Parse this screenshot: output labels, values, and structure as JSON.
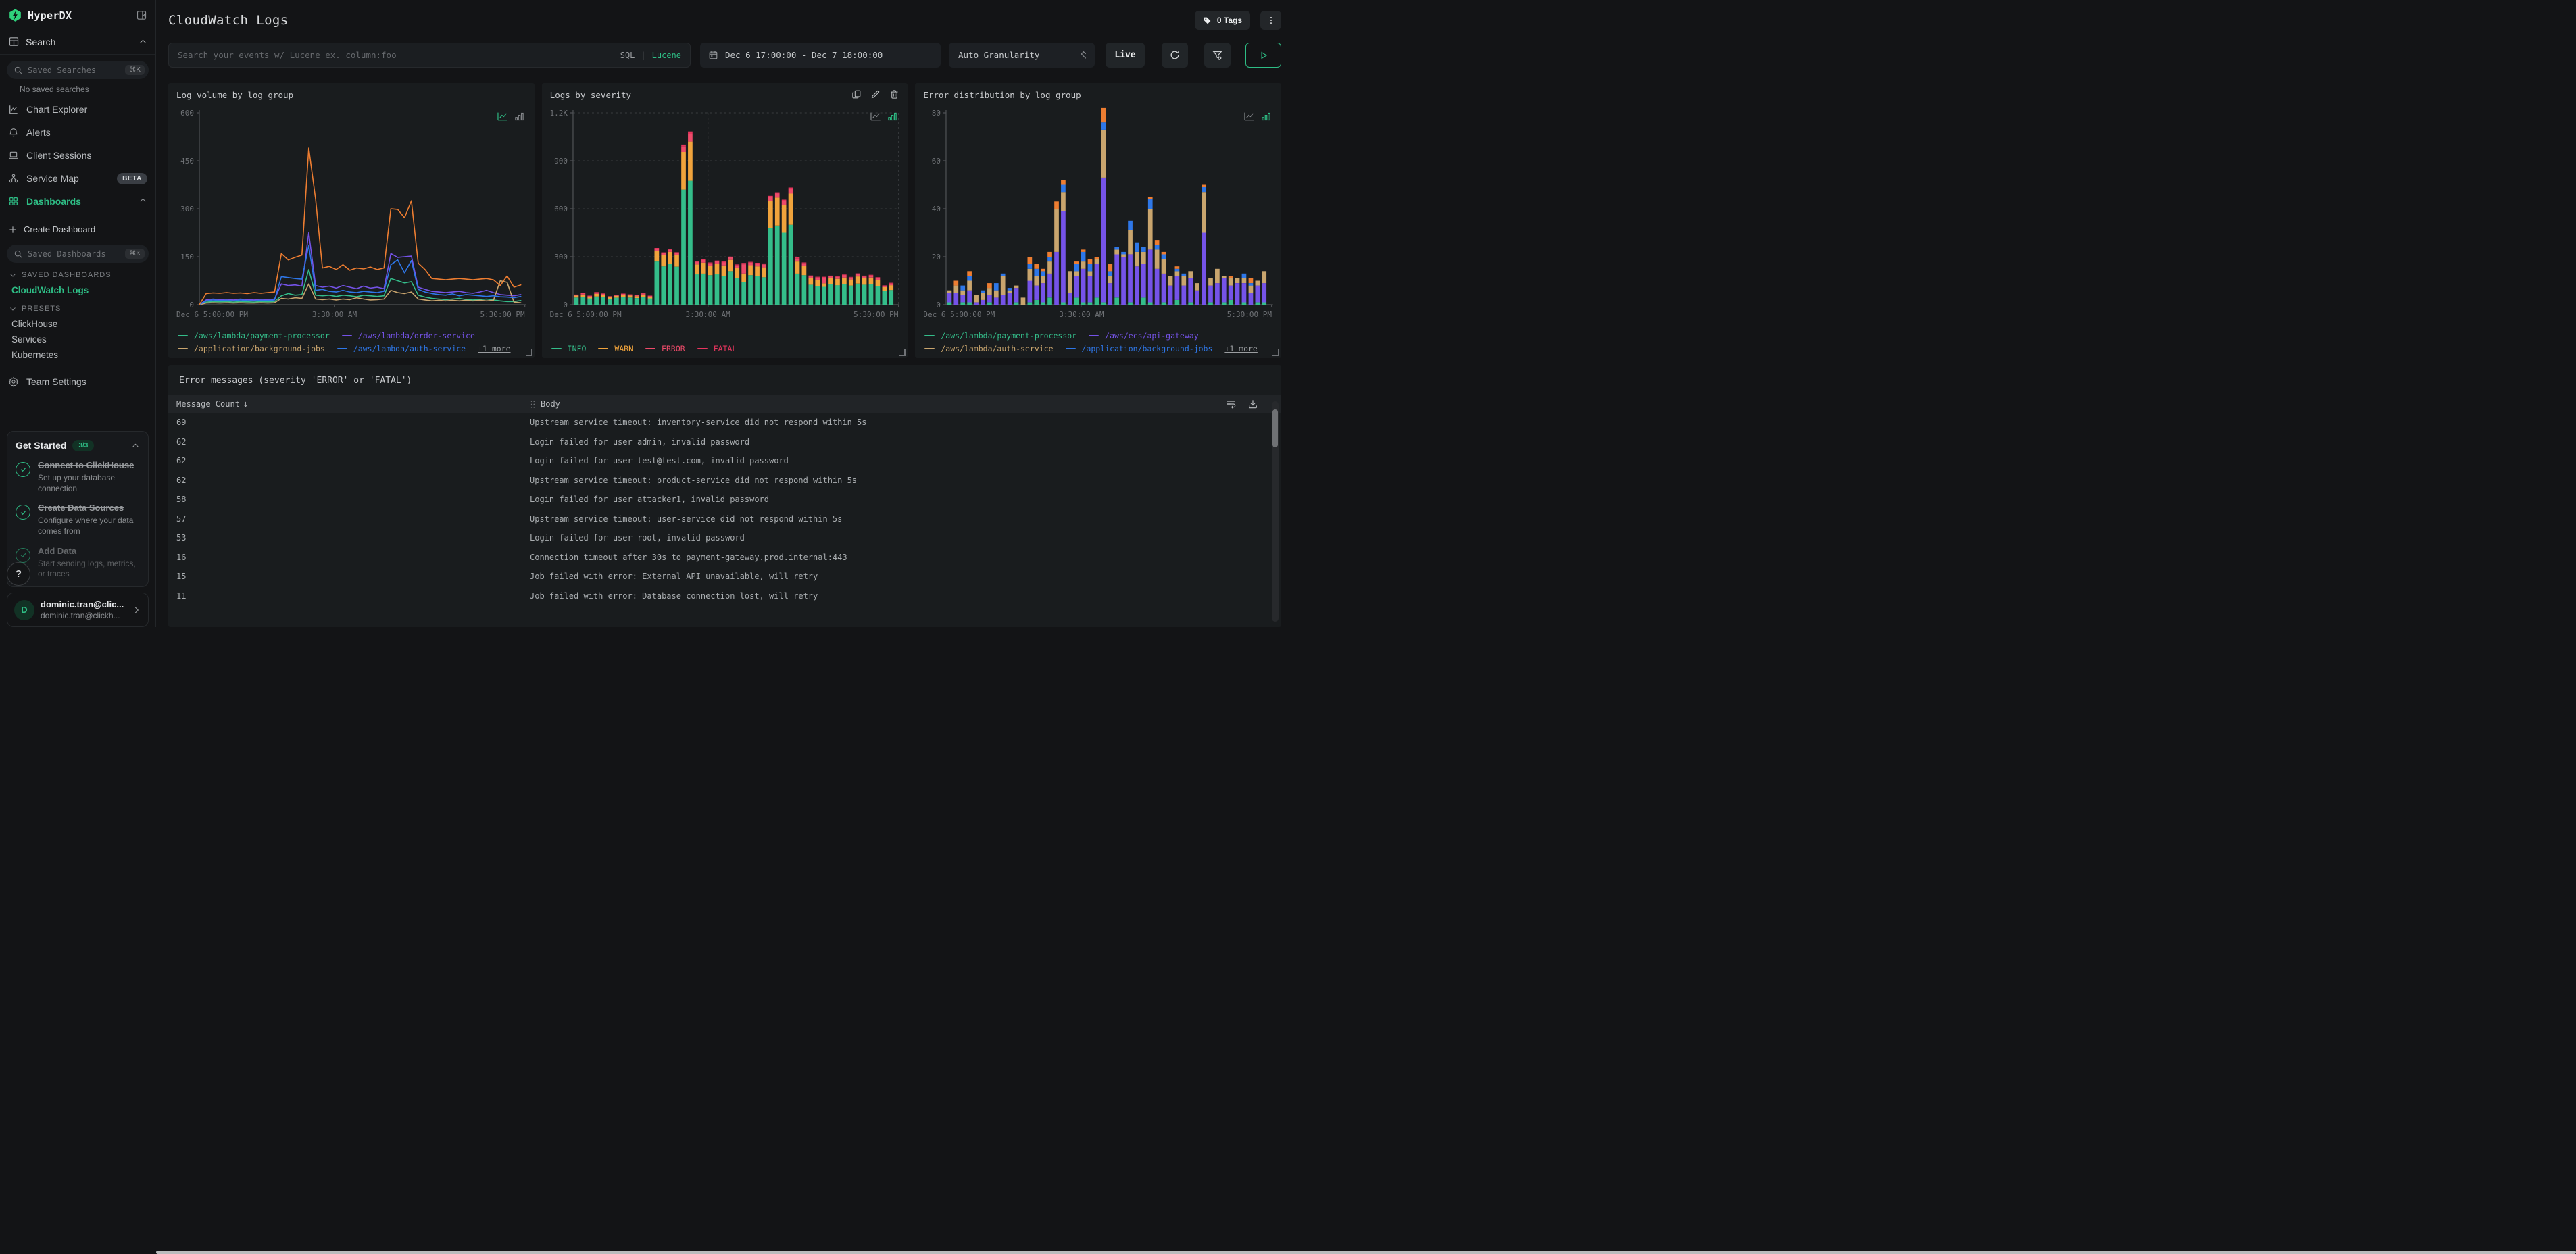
{
  "app": {
    "name": "HyperDX"
  },
  "sidebar": {
    "search_section_label": "Search",
    "saved_searches_placeholder": "Saved Searches",
    "shortcut": "⌘K",
    "no_saved": "No saved searches",
    "nav": [
      {
        "icon": "chart-explorer",
        "label": "Chart Explorer"
      },
      {
        "icon": "bell",
        "label": "Alerts"
      },
      {
        "icon": "laptop",
        "label": "Client Sessions"
      },
      {
        "icon": "service-map",
        "label": "Service Map",
        "badge": "BETA"
      },
      {
        "icon": "dashboards",
        "label": "Dashboards",
        "active": true,
        "chevron": "up"
      }
    ],
    "create_dashboard": "Create Dashboard",
    "saved_dashboards_placeholder": "Saved Dashboards",
    "sections": [
      {
        "label": "SAVED DASHBOARDS",
        "items": [
          {
            "label": "CloudWatch Logs",
            "active": true
          }
        ]
      },
      {
        "label": "PRESETS",
        "items": [
          {
            "label": "ClickHouse"
          },
          {
            "label": "Services"
          },
          {
            "label": "Kubernetes"
          }
        ]
      }
    ],
    "team_settings": "Team Settings",
    "get_started": {
      "title": "Get Started",
      "badge": "3/3",
      "items": [
        {
          "title": "Connect to ClickHouse",
          "desc": "Set up your database connection",
          "done": true
        },
        {
          "title": "Create Data Sources",
          "desc": "Configure where your data comes from",
          "done": true
        },
        {
          "title": "Add Data",
          "desc": "Start sending logs, metrics, or traces",
          "done": true
        }
      ]
    },
    "help_label": "?",
    "user": {
      "initial": "D",
      "name": "dominic.tran@clic...",
      "email": "dominic.tran@clickh..."
    }
  },
  "header": {
    "title": "CloudWatch Logs",
    "tags_label": "0 Tags"
  },
  "toolbar": {
    "search_placeholder": "Search your events w/ Lucene ex. column:foo",
    "sql_label": "SQL",
    "divider": "|",
    "lucene_label": "Lucene",
    "time_range": "Dec 6 17:00:00 - Dec 7 18:00:00",
    "granularity": "Auto Granularity",
    "live_label": "Live"
  },
  "colors": {
    "accent": "#2ebd85",
    "orange": "#ed7d31",
    "purple": "#7553e8",
    "blue": "#2e77e8",
    "tan": "#c9a56e",
    "green": "#34bd8a",
    "warn": "#f0a33c",
    "error": "#ee4b6a",
    "fatal": "#e8355e"
  },
  "chart_data": [
    {
      "id": "log-volume",
      "type": "line",
      "title": "Log volume by log group",
      "ylim": [
        0,
        600
      ],
      "yticks": [
        0,
        150,
        300,
        450,
        600
      ],
      "ytick_labels": [
        "0",
        "150",
        "300",
        "450",
        "600"
      ],
      "xticks": [
        "Dec 6 5:00:00 PM",
        "3:30:00 AM",
        "5:30:00 PM"
      ],
      "grid": false,
      "active_view": "line",
      "series": [
        {
          "name": "/aws/lambda/payment-processor",
          "color": "#34bd8a",
          "values": [
            0,
            8,
            10,
            9,
            10,
            8,
            10,
            9,
            8,
            10,
            9,
            10,
            28,
            35,
            30,
            32,
            110,
            30,
            28,
            30,
            26,
            30,
            28,
            25,
            30,
            28,
            26,
            28,
            82,
            75,
            68,
            72,
            30,
            24,
            20,
            18,
            16,
            18,
            20,
            16,
            15,
            16,
            18,
            15,
            12,
            10,
            10,
            13
          ]
        },
        {
          "name": "/aws/lambda/order-service",
          "color": "#7553e8",
          "values": [
            0,
            15,
            18,
            16,
            17,
            15,
            18,
            16,
            15,
            17,
            16,
            18,
            65,
            60,
            62,
            58,
            225,
            60,
            55,
            58,
            52,
            60,
            55,
            50,
            58,
            52,
            55,
            50,
            160,
            148,
            150,
            152,
            55,
            48,
            42,
            40,
            38,
            40,
            42,
            38,
            36,
            40,
            45,
            38,
            32,
            30,
            28,
            32
          ]
        },
        {
          "name": "/application/background-jobs",
          "color": "#c9a56e",
          "values": [
            0,
            5,
            6,
            5,
            6,
            5,
            6,
            5,
            5,
            6,
            5,
            6,
            20,
            18,
            22,
            20,
            65,
            18,
            16,
            18,
            15,
            18,
            16,
            22,
            18,
            15,
            16,
            18,
            45,
            38,
            35,
            40,
            18,
            15,
            12,
            14,
            12,
            14,
            12,
            14,
            12,
            14,
            12,
            14,
            75,
            70,
            8,
            6
          ]
        },
        {
          "name": "/aws/lambda/auth-service",
          "color": "#2e77e8",
          "values": [
            0,
            12,
            15,
            13,
            14,
            12,
            15,
            13,
            12,
            14,
            13,
            15,
            88,
            85,
            82,
            80,
            185,
            45,
            48,
            42,
            40,
            45,
            40,
            38,
            42,
            40,
            38,
            42,
            125,
            140,
            100,
            138,
            48,
            40,
            35,
            32,
            30,
            34,
            28,
            32,
            30,
            28,
            26,
            28,
            25,
            24,
            22,
            26
          ]
        },
        {
          "name": "+1 more",
          "color": "#ed7d31",
          "values": [
            0,
            35,
            37,
            36,
            38,
            36,
            37,
            35,
            38,
            36,
            38,
            40,
            160,
            140,
            148,
            155,
            490,
            330,
            115,
            120,
            110,
            125,
            108,
            115,
            112,
            118,
            110,
            115,
            300,
            298,
            272,
            325,
            130,
            110,
            82,
            80,
            78,
            80,
            82,
            80,
            78,
            80,
            82,
            78,
            60,
            90,
            55,
            62
          ]
        }
      ],
      "legend": [
        {
          "label": "/aws/lambda/payment-processor",
          "color": "#34bd8a"
        },
        {
          "label": "/aws/lambda/order-service",
          "color": "#7553e8"
        },
        {
          "label": "/application/background-jobs",
          "color": "#c9a56e"
        },
        {
          "label": "/aws/lambda/auth-service",
          "color": "#2e77e8"
        },
        {
          "label": "+1 more",
          "more": true
        }
      ],
      "legend_split": 2
    },
    {
      "id": "logs-by-severity",
      "type": "bar",
      "title": "Logs by severity",
      "ylim": [
        0,
        1200
      ],
      "yticks": [
        0,
        300,
        600,
        900,
        1200
      ],
      "ytick_labels": [
        "0",
        "300",
        "600",
        "900",
        "1.2K"
      ],
      "xticks": [
        "Dec 6 5:00:00 PM",
        "3:30:00 AM",
        "5:30:00 PM"
      ],
      "grid": true,
      "active_view": "bar",
      "hover_actions": true,
      "series": [
        {
          "name": "INFO",
          "color": "#34bd8a",
          "values": [
            45,
            50,
            40,
            52,
            48,
            38,
            44,
            48,
            45,
            42,
            50,
            40,
            270,
            240,
            255,
            238,
            720,
            775,
            190,
            195,
            185,
            190,
            178,
            210,
            168,
            140,
            185,
            180,
            172,
            478,
            495,
            450,
            500,
            195,
            185,
            125,
            118,
            112,
            128,
            122,
            128,
            120,
            132,
            125,
            128,
            118,
            85,
            92
          ]
        },
        {
          "name": "WARN",
          "color": "#f0a33c",
          "values": [
            12,
            14,
            10,
            16,
            15,
            10,
            12,
            14,
            12,
            12,
            14,
            10,
            65,
            70,
            75,
            72,
            235,
            245,
            62,
            68,
            60,
            65,
            68,
            70,
            62,
            55,
            62,
            60,
            62,
            170,
            175,
            172,
            195,
            75,
            60,
            42,
            38,
            22,
            38,
            40,
            42,
            38,
            45,
            40,
            42,
            38,
            25,
            30
          ]
        },
        {
          "name": "ERROR",
          "color": "#ee4b6a",
          "values": [
            5,
            6,
            5,
            8,
            6,
            4,
            5,
            6,
            6,
            6,
            7,
            5,
            15,
            12,
            14,
            14,
            35,
            45,
            16,
            16,
            14,
            16,
            18,
            16,
            16,
            58,
            16,
            16,
            18,
            25,
            25,
            25,
            28,
            20,
            14,
            12,
            14,
            35,
            12,
            12,
            14,
            12,
            14,
            12,
            12,
            12,
            8,
            10
          ]
        },
        {
          "name": "FATAL",
          "color": "#e8355e",
          "values": [
            2,
            2,
            2,
            3,
            2,
            2,
            2,
            2,
            2,
            3,
            2,
            2,
            5,
            5,
            5,
            4,
            12,
            18,
            5,
            5,
            5,
            5,
            6,
            5,
            6,
            8,
            5,
            6,
            6,
            8,
            8,
            10,
            10,
            6,
            5,
            4,
            5,
            6,
            4,
            5,
            5,
            4,
            5,
            5,
            5,
            4,
            3,
            5
          ]
        }
      ],
      "legend": [
        {
          "label": "INFO",
          "color": "#34bd8a"
        },
        {
          "label": "WARN",
          "color": "#f0a33c"
        },
        {
          "label": "ERROR",
          "color": "#ee4b6a"
        },
        {
          "label": "FATAL",
          "color": "#e8355e"
        }
      ],
      "legend_split": 4
    },
    {
      "id": "error-distribution",
      "type": "bar",
      "title": "Error distribution by log group",
      "ylim": [
        0,
        80
      ],
      "yticks": [
        0,
        20,
        40,
        60,
        80
      ],
      "ytick_labels": [
        "0",
        "20",
        "40",
        "60",
        "80"
      ],
      "xticks": [
        "Dec 6 5:00:00 PM",
        "3:30:00 AM",
        "5:30:00 PM"
      ],
      "grid": false,
      "active_view": "bar",
      "series": [
        {
          "name": "/aws/lambda/payment-processor",
          "color": "#34bd8a",
          "values": [
            1,
            0,
            1,
            1,
            0,
            0,
            1,
            0,
            0,
            0,
            1,
            0,
            1,
            2,
            1,
            3,
            0,
            1,
            0,
            3,
            1,
            1,
            3,
            1,
            0,
            3,
            0,
            1,
            0,
            3,
            1,
            0,
            1,
            0,
            2,
            0,
            1,
            0,
            0,
            1,
            0,
            1,
            2,
            0,
            1,
            0,
            1,
            1
          ]
        },
        {
          "name": "/aws/ecs/api-gateway",
          "color": "#7553e8",
          "values": [
            4,
            5,
            3,
            5,
            1,
            2,
            3,
            3,
            4,
            5,
            6,
            0,
            9,
            6,
            8,
            10,
            22,
            38,
            5,
            9,
            14,
            11,
            14,
            52,
            9,
            18,
            20,
            20,
            16,
            14,
            22,
            15,
            12,
            8,
            10,
            8,
            10,
            6,
            30,
            7,
            9,
            10,
            6,
            9,
            8,
            5,
            7,
            8
          ]
        },
        {
          "name": "/aws/lambda/auth-service",
          "color": "#c9a56e",
          "values": [
            1,
            3,
            2,
            4,
            3,
            3,
            3,
            3,
            8,
            1,
            1,
            3,
            5,
            4,
            3,
            5,
            18,
            8,
            9,
            2,
            3,
            2,
            2,
            20,
            3,
            2,
            1,
            10,
            6,
            5,
            17,
            8,
            6,
            4,
            2,
            4,
            3,
            3,
            17,
            3,
            6,
            1,
            3,
            2,
            2,
            3,
            2,
            5
          ]
        },
        {
          "name": "/application/background-jobs",
          "color": "#2e77e8",
          "values": [
            0,
            0,
            2,
            2,
            0,
            1,
            0,
            3,
            1,
            1,
            0,
            0,
            2,
            3,
            2,
            2,
            0,
            3,
            0,
            3,
            4,
            3,
            0,
            3,
            2,
            1,
            1,
            4,
            4,
            2,
            4,
            2,
            2,
            0,
            1,
            1,
            0,
            0,
            2,
            0,
            0,
            0,
            0,
            0,
            2,
            1,
            0,
            0
          ]
        },
        {
          "name": "+1 more",
          "color": "#ed7d31",
          "values": [
            0,
            2,
            0,
            2,
            0,
            0,
            2,
            0,
            0,
            0,
            0,
            0,
            3,
            2,
            1,
            2,
            3,
            2,
            0,
            1,
            1,
            2,
            1,
            6,
            3,
            0,
            0,
            0,
            0,
            0,
            1,
            2,
            1,
            0,
            1,
            0,
            0,
            0,
            1,
            0,
            0,
            0,
            1,
            0,
            0,
            2,
            0,
            0
          ]
        }
      ],
      "legend": [
        {
          "label": "/aws/lambda/payment-processor",
          "color": "#34bd8a"
        },
        {
          "label": "/aws/ecs/api-gateway",
          "color": "#7553e8"
        },
        {
          "label": "/aws/lambda/auth-service",
          "color": "#c9a56e"
        },
        {
          "label": "/application/background-jobs",
          "color": "#2e77e8"
        },
        {
          "label": "+1 more",
          "more": true
        }
      ],
      "legend_split": 2
    }
  ],
  "table": {
    "title": "Error messages (severity 'ERROR' or 'FATAL')",
    "columns": [
      {
        "label": "Message Count",
        "sort": "desc"
      },
      {
        "label": "Body"
      }
    ],
    "rows": [
      {
        "count": "69",
        "body": "Upstream service timeout: inventory-service did not respond within 5s"
      },
      {
        "count": "62",
        "body": "Login failed for user admin, invalid password"
      },
      {
        "count": "62",
        "body": "Login failed for user test@test.com, invalid password"
      },
      {
        "count": "62",
        "body": "Upstream service timeout: product-service did not respond within 5s"
      },
      {
        "count": "58",
        "body": "Login failed for user attacker1, invalid password"
      },
      {
        "count": "57",
        "body": "Upstream service timeout: user-service did not respond within 5s"
      },
      {
        "count": "53",
        "body": "Login failed for user root, invalid password"
      },
      {
        "count": "16",
        "body": "Connection timeout after 30s to payment-gateway.prod.internal:443"
      },
      {
        "count": "15",
        "body": "Job failed with error: External API unavailable, will retry"
      },
      {
        "count": "11",
        "body": "Job failed with error: Database connection lost, will retry"
      }
    ]
  }
}
